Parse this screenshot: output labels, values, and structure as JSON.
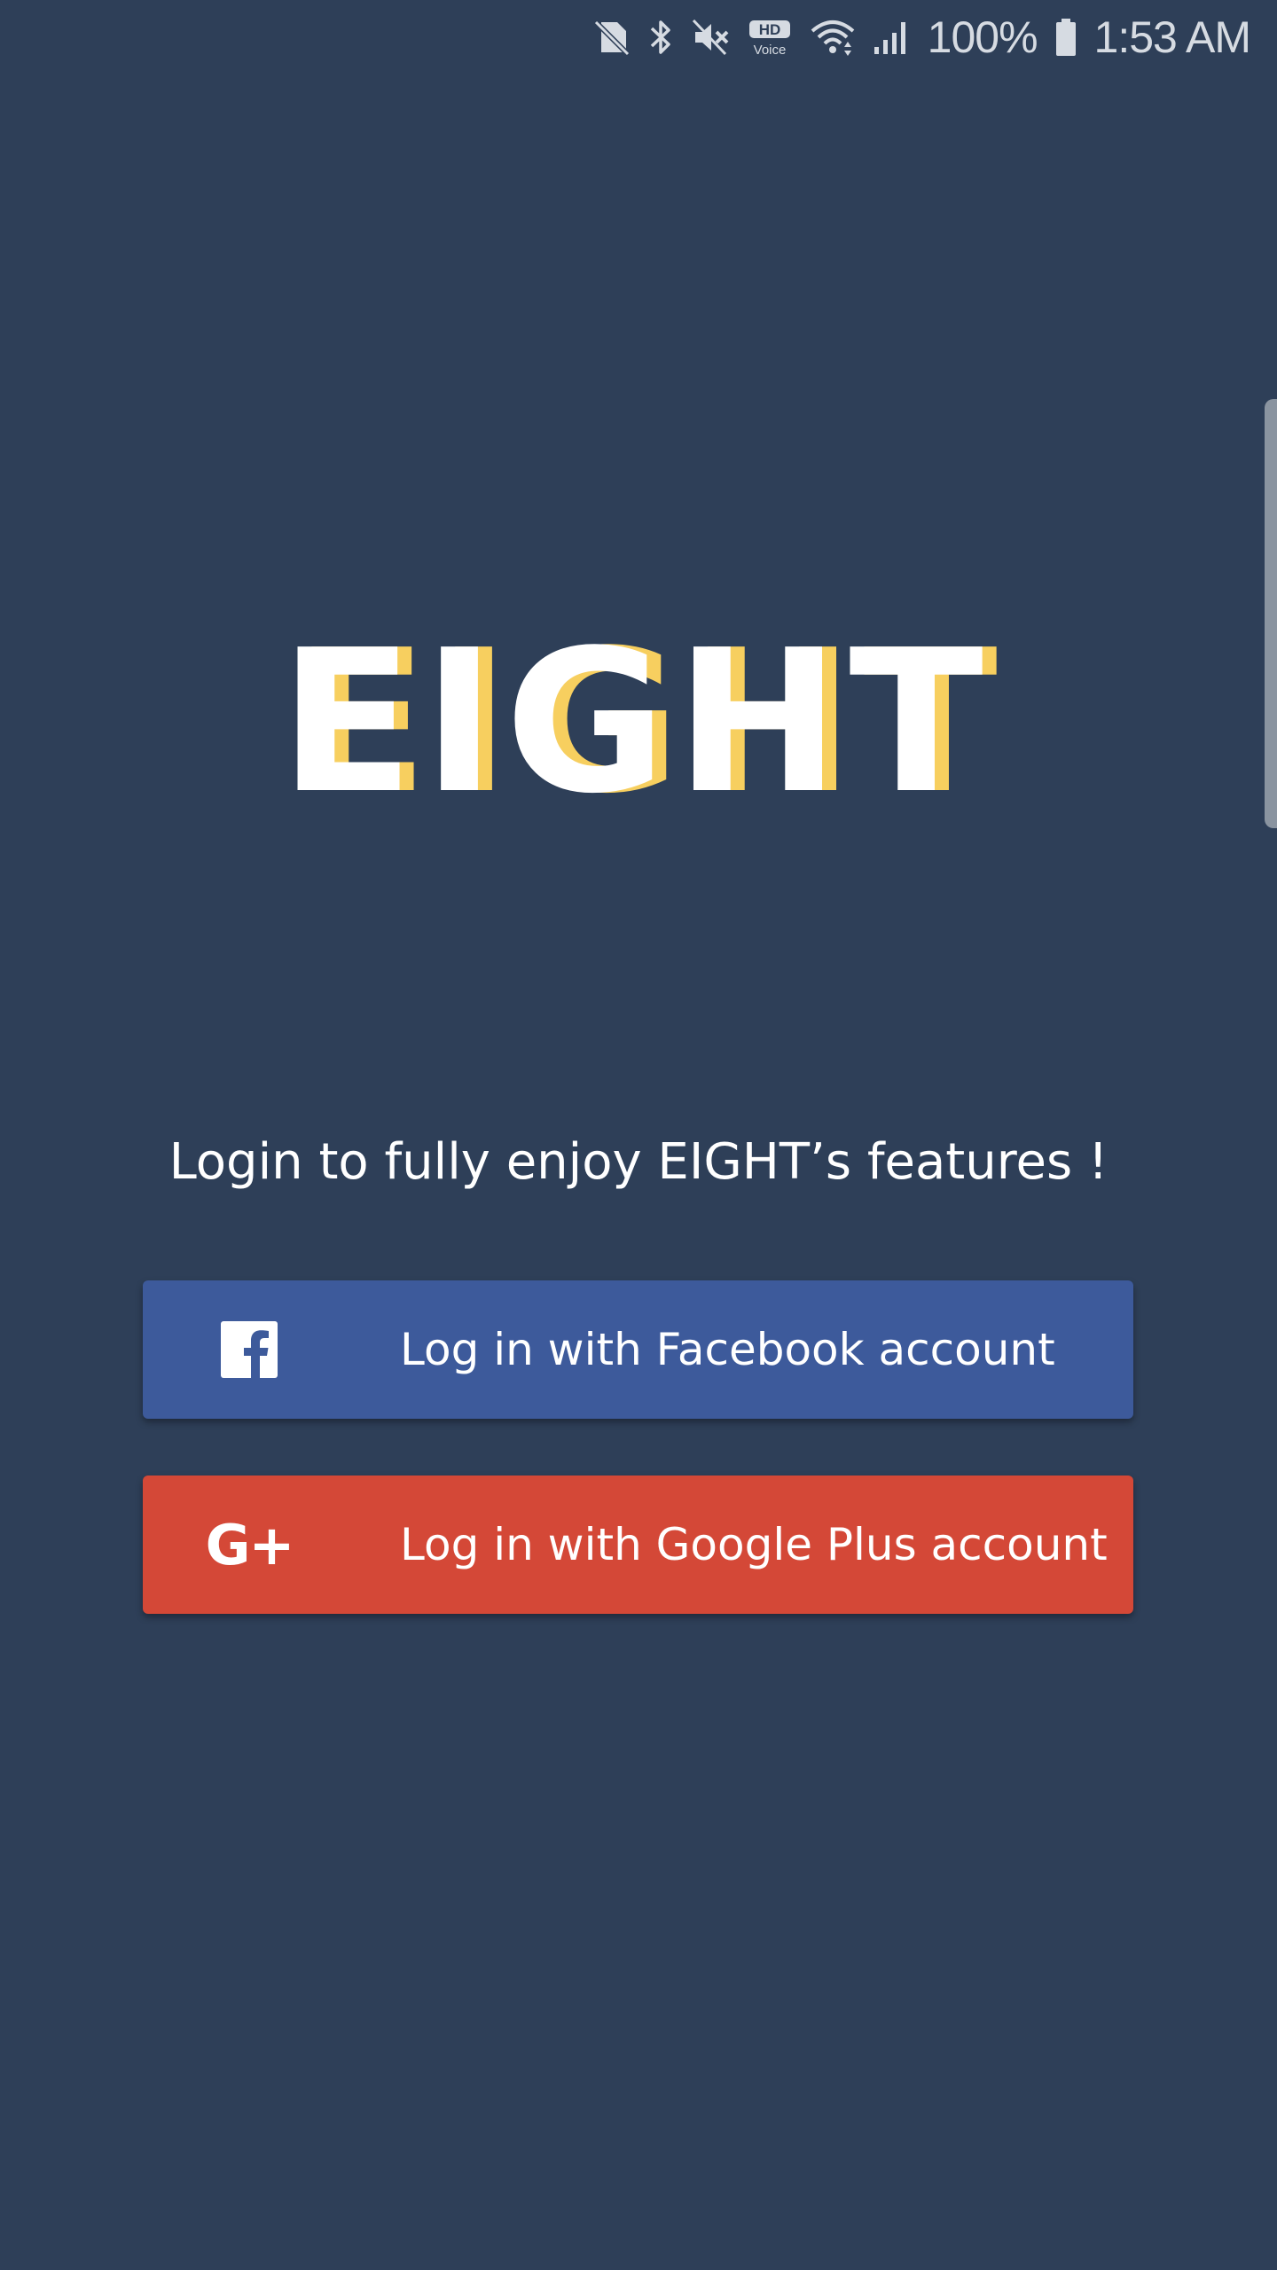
{
  "status_bar": {
    "battery_percent": "100%",
    "time": "1:53 AM",
    "icons": [
      "no-sim-icon",
      "bluetooth-icon",
      "mute-icon",
      "hd-voice-icon",
      "wifi-icon",
      "signal-icon",
      "battery-icon"
    ],
    "hd_label": "HD",
    "voice_label": "Voice"
  },
  "app": {
    "logo_text": "EIGHT",
    "logo_colors": {
      "primary": "#ffffff",
      "shadow": "#f7cf5f"
    },
    "tagline": "Login to fully enjoy EIGHT’s features !"
  },
  "buttons": {
    "facebook": {
      "label": "Log in with Facebook account",
      "icon": "facebook-icon",
      "color": "#3d5a9b"
    },
    "google": {
      "label": "Log in with Google Plus account",
      "icon": "google-plus-icon",
      "icon_text": "G+",
      "color": "#d44837"
    }
  },
  "colors": {
    "background": "#2e3f58",
    "text": "#ffffff",
    "status_text": "#d6dbe2"
  }
}
